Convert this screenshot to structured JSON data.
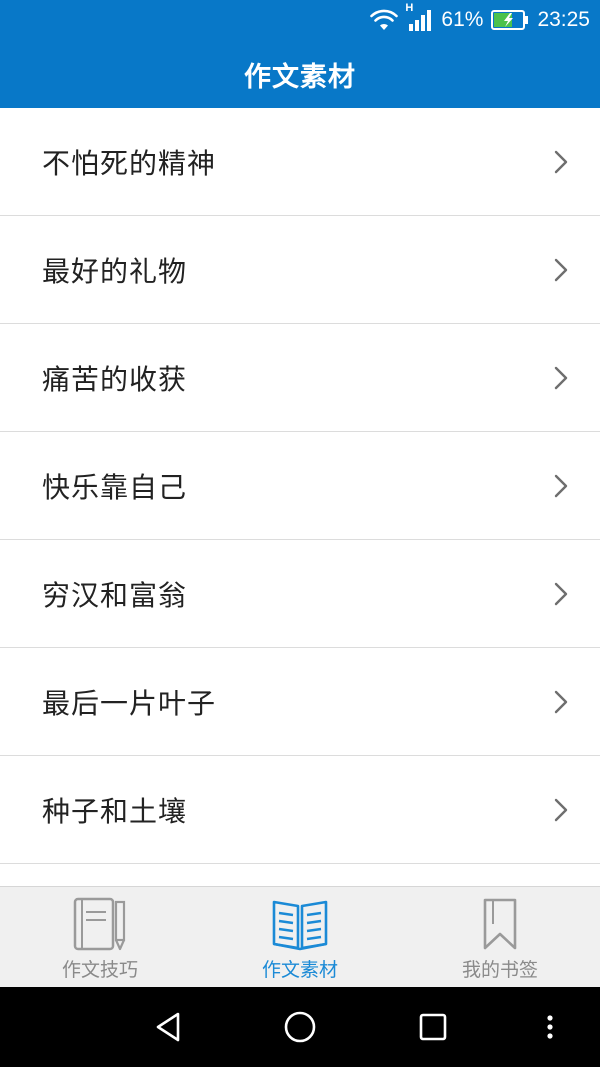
{
  "status_bar": {
    "battery_percent": "61%",
    "time": "23:25",
    "signal_label": "H",
    "icons": [
      "wifi-icon",
      "cellular-signal-icon",
      "battery-charging-icon"
    ]
  },
  "header": {
    "title": "作文素材"
  },
  "list": {
    "items": [
      {
        "label": "不怕死的精神"
      },
      {
        "label": "最好的礼物"
      },
      {
        "label": "痛苦的收获"
      },
      {
        "label": "快乐靠自己"
      },
      {
        "label": "穷汉和富翁"
      },
      {
        "label": "最后一片叶子"
      },
      {
        "label": "种子和土壤"
      }
    ],
    "chevron_icon": "chevron-right-icon"
  },
  "tabs": [
    {
      "label": "作文技巧",
      "icon": "notebook-pencil-icon",
      "active": false
    },
    {
      "label": "作文素材",
      "icon": "open-book-icon",
      "active": true
    },
    {
      "label": "我的书签",
      "icon": "bookmark-icon",
      "active": false
    }
  ],
  "nav_bar": {
    "icons": [
      "back-triangle-icon",
      "home-circle-icon",
      "recents-square-icon",
      "more-dots-icon"
    ]
  },
  "colors": {
    "header_blue": "#0878c8",
    "active_tab": "#1b8ad6",
    "inactive_tab": "#8a8a8a"
  }
}
